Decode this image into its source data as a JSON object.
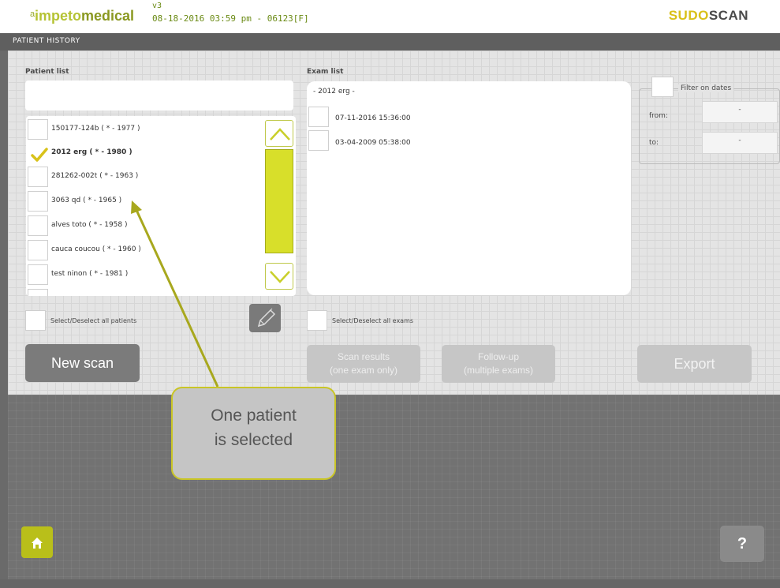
{
  "header": {
    "logo_sup": "a",
    "logo_part1": "impeto",
    "logo_part2": "medical",
    "version": "v3",
    "timestamp": "08-18-2016 03:59 pm - 06123[F]",
    "brand_part1": "SUDO",
    "brand_part2": "SCAN"
  },
  "section_title": "PATIENT HISTORY",
  "patient_panel": {
    "label": "Patient list",
    "search_value": "",
    "patients": [
      {
        "name": "150177-124b",
        "years": "( * - 1977 )",
        "selected": false
      },
      {
        "name": "2012 erg",
        "years": "( * - 1980 )",
        "selected": true
      },
      {
        "name": "281262-002t",
        "years": "( * - 1963 )",
        "selected": false
      },
      {
        "name": "3063 qd",
        "years": "( * - 1965 )",
        "selected": false
      },
      {
        "name": "alves toto",
        "years": "( * - 1958 )",
        "selected": false
      },
      {
        "name": "cauca coucou",
        "years": "( * - 1960 )",
        "selected": false
      },
      {
        "name": "test ninon",
        "years": "( * - 1981 )",
        "selected": false
      }
    ],
    "select_all_label": "Select/Deselect all patients"
  },
  "exam_panel": {
    "label": "Exam list",
    "group_label": "- 2012 erg -",
    "exams": [
      "07-11-2016 15:36:00",
      "03-04-2009 05:38:00"
    ],
    "select_all_label": "Select/Deselect all exams"
  },
  "filter": {
    "label": "Filter on dates",
    "from_label": "from:",
    "to_label": "to:",
    "from_value": "-",
    "to_value": "-"
  },
  "buttons": {
    "new_scan": "New scan",
    "scan_results_line1": "Scan results",
    "scan_results_line2": "(one exam only)",
    "follow_up_line1": "Follow-up",
    "follow_up_line2": "(multiple exams)",
    "export": "Export",
    "help": "?"
  },
  "callout": {
    "line1": "One patient",
    "line2": "is selected"
  },
  "colors": {
    "accent": "#d8df2a",
    "brand_green": "#b5c334",
    "callout_border": "#c9c526"
  }
}
